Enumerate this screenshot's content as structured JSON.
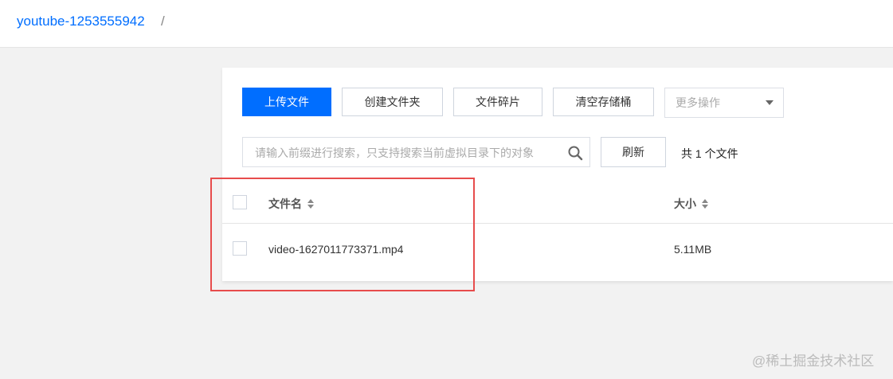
{
  "header": {
    "bucket_name": "youtube-1253555942",
    "separator": "/"
  },
  "toolbar": {
    "upload_label": "上传文件",
    "create_folder_label": "创建文件夹",
    "file_fragments_label": "文件碎片",
    "clear_bucket_label": "清空存储桶",
    "more_actions_label": "更多操作"
  },
  "search": {
    "placeholder": "请输入前缀进行搜索，只支持搜索当前虚拟目录下的对象",
    "value": "",
    "refresh_label": "刷新",
    "count_text": "共 1 个文件"
  },
  "table": {
    "columns": [
      "文件名",
      "大小"
    ],
    "rows": [
      {
        "name": "video-1627011773371.mp4",
        "size": "5.11MB"
      }
    ]
  },
  "watermark": "@稀土掘金技术社区",
  "colors": {
    "primary": "#006eff",
    "highlight_box": "#e74c4c",
    "background": "#f2f2f2"
  }
}
